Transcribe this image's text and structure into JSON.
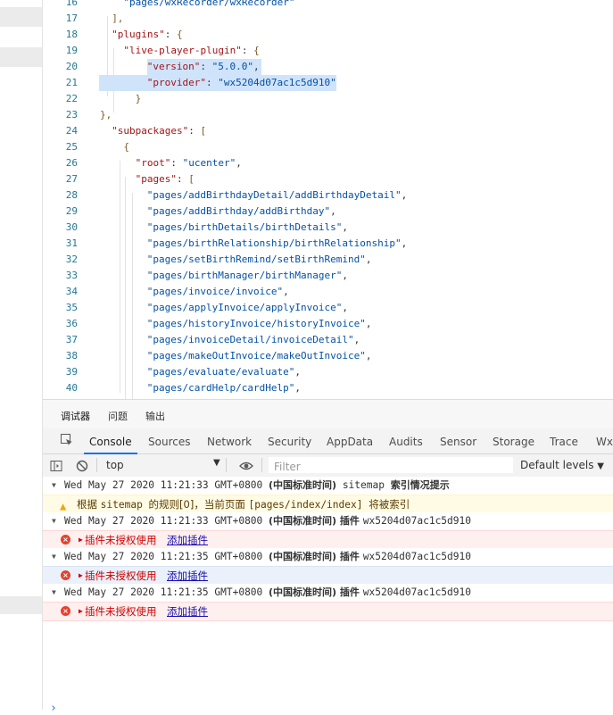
{
  "editor": {
    "lines": [
      {
        "n": "16",
        "indent": 1,
        "parts": [
          {
            "t": "\"pages/wxRecorder/wxRecorder\"",
            "c": "s"
          }
        ]
      },
      {
        "n": "17",
        "indent": 0.5,
        "parts": [
          {
            "t": "],",
            "c": "b"
          }
        ]
      },
      {
        "n": "18",
        "indent": 0.5,
        "parts": [
          {
            "t": "\"plugins\"",
            "c": "k"
          },
          {
            "t": ": ",
            "c": "p"
          },
          {
            "t": "{",
            "c": "b"
          }
        ]
      },
      {
        "n": "19",
        "indent": 1,
        "parts": [
          {
            "t": "\"live-player-plugin\"",
            "c": "k"
          },
          {
            "t": ": ",
            "c": "p"
          },
          {
            "t": "{",
            "c": "b"
          }
        ]
      },
      {
        "n": "20",
        "indent": 2,
        "parts": [
          {
            "t": "\"version\"",
            "c": "k"
          },
          {
            "t": ": ",
            "c": "p"
          },
          {
            "t": "\"5.0.0\"",
            "c": "s"
          },
          {
            "t": ",",
            "c": "p"
          }
        ]
      },
      {
        "n": "21",
        "indent": 2,
        "parts": [
          {
            "t": "\"provider\"",
            "c": "k"
          },
          {
            "t": ": ",
            "c": "p"
          },
          {
            "t": "\"wx5204d07ac1c5d910\"",
            "c": "s"
          }
        ]
      },
      {
        "n": "22",
        "indent": 1.5,
        "parts": [
          {
            "t": "}",
            "c": "b"
          }
        ]
      },
      {
        "n": "23",
        "indent": 0,
        "parts": [
          {
            "t": "},",
            "c": "b"
          }
        ]
      },
      {
        "n": "24",
        "indent": 0.5,
        "parts": [
          {
            "t": "\"subpackages\"",
            "c": "k"
          },
          {
            "t": ": ",
            "c": "p"
          },
          {
            "t": "[",
            "c": "b"
          }
        ]
      },
      {
        "n": "25",
        "indent": 1,
        "parts": [
          {
            "t": "{",
            "c": "b"
          }
        ]
      },
      {
        "n": "26",
        "indent": 1.5,
        "parts": [
          {
            "t": "\"root\"",
            "c": "k"
          },
          {
            "t": ": ",
            "c": "p"
          },
          {
            "t": "\"ucenter\"",
            "c": "s"
          },
          {
            "t": ",",
            "c": "p"
          }
        ]
      },
      {
        "n": "27",
        "indent": 1.5,
        "parts": [
          {
            "t": "\"pages\"",
            "c": "k"
          },
          {
            "t": ": ",
            "c": "p"
          },
          {
            "t": "[",
            "c": "b"
          }
        ]
      },
      {
        "n": "28",
        "indent": 2,
        "parts": [
          {
            "t": "\"pages/addBirthdayDetail/addBirthdayDetail\"",
            "c": "s"
          },
          {
            "t": ",",
            "c": "p"
          }
        ]
      },
      {
        "n": "29",
        "indent": 2,
        "parts": [
          {
            "t": "\"pages/addBirthday/addBirthday\"",
            "c": "s"
          },
          {
            "t": ",",
            "c": "p"
          }
        ]
      },
      {
        "n": "30",
        "indent": 2,
        "parts": [
          {
            "t": "\"pages/birthDetails/birthDetails\"",
            "c": "s"
          },
          {
            "t": ",",
            "c": "p"
          }
        ]
      },
      {
        "n": "31",
        "indent": 2,
        "parts": [
          {
            "t": "\"pages/birthRelationship/birthRelationship\"",
            "c": "s"
          },
          {
            "t": ",",
            "c": "p"
          }
        ]
      },
      {
        "n": "32",
        "indent": 2,
        "parts": [
          {
            "t": "\"pages/setBirthRemind/setBirthRemind\"",
            "c": "s"
          },
          {
            "t": ",",
            "c": "p"
          }
        ]
      },
      {
        "n": "33",
        "indent": 2,
        "parts": [
          {
            "t": "\"pages/birthManager/birthManager\"",
            "c": "s"
          },
          {
            "t": ",",
            "c": "p"
          }
        ]
      },
      {
        "n": "34",
        "indent": 2,
        "parts": [
          {
            "t": "\"pages/invoice/invoice\"",
            "c": "s"
          },
          {
            "t": ",",
            "c": "p"
          }
        ]
      },
      {
        "n": "35",
        "indent": 2,
        "parts": [
          {
            "t": "\"pages/applyInvoice/applyInvoice\"",
            "c": "s"
          },
          {
            "t": ",",
            "c": "p"
          }
        ]
      },
      {
        "n": "36",
        "indent": 2,
        "parts": [
          {
            "t": "\"pages/historyInvoice/historyInvoice\"",
            "c": "s"
          },
          {
            "t": ",",
            "c": "p"
          }
        ]
      },
      {
        "n": "37",
        "indent": 2,
        "parts": [
          {
            "t": "\"pages/invoiceDetail/invoiceDetail\"",
            "c": "s"
          },
          {
            "t": ",",
            "c": "p"
          }
        ]
      },
      {
        "n": "38",
        "indent": 2,
        "parts": [
          {
            "t": "\"pages/makeOutInvoice/makeOutInvoice\"",
            "c": "s"
          },
          {
            "t": ",",
            "c": "p"
          }
        ]
      },
      {
        "n": "39",
        "indent": 2,
        "parts": [
          {
            "t": "\"pages/evaluate/evaluate\"",
            "c": "s"
          },
          {
            "t": ",",
            "c": "p"
          }
        ]
      },
      {
        "n": "40",
        "indent": 2,
        "parts": [
          {
            "t": "\"pages/cardHelp/cardHelp\"",
            "c": "s"
          },
          {
            "t": ",",
            "c": "p"
          }
        ]
      }
    ],
    "selected_lines": [
      "20",
      "21"
    ]
  },
  "devtools": {
    "top_tabs": [
      "调试器",
      "问题",
      "输出"
    ],
    "active_top_tab": "调试器",
    "panel_tabs": [
      "Console",
      "Sources",
      "Network",
      "Security",
      "AppData",
      "Audits",
      "Sensor",
      "Storage",
      "Trace",
      "Wxml"
    ],
    "active_panel_tab": "Console",
    "toolbar": {
      "context": "top",
      "filter_placeholder": "Filter",
      "levels": "Default levels"
    },
    "messages": [
      {
        "type": "group",
        "time": "Wed May 27 2020 11:21:33 GMT+0800",
        "cn": "(中国标准时间)",
        "rest_cn": "sitemap",
        "tail": "索引情况提示"
      },
      {
        "type": "warn",
        "text_cn1": "根据",
        "text_mono1": "sitemap",
        "text_cn2": "的规则[0]，当前页面",
        "text_mono2": "[pages/index/index]",
        "text_cn3": "将被索引"
      },
      {
        "type": "group",
        "time": "Wed May 27 2020 11:21:33 GMT+0800",
        "cn": "(中国标准时间)",
        "rest_cn": "插件",
        "tail": "wx5204d07ac1c5d910"
      },
      {
        "type": "error",
        "text": "插件未授权使用",
        "link": "添加插件",
        "alt": false
      },
      {
        "type": "group",
        "time": "Wed May 27 2020 11:21:35 GMT+0800",
        "cn": "(中国标准时间)",
        "rest_cn": "插件",
        "tail": "wx5204d07ac1c5d910"
      },
      {
        "type": "error",
        "text": "插件未授权使用",
        "link": "添加插件",
        "alt": true
      },
      {
        "type": "group",
        "time": "Wed May 27 2020 11:21:35 GMT+0800",
        "cn": "(中国标准时间)",
        "rest_cn": "插件",
        "tail": "wx5204d07ac1c5d910"
      },
      {
        "type": "error",
        "text": "插件未授权使用",
        "link": "添加插件",
        "alt": false
      }
    ],
    "prompt": "›"
  },
  "colors": {
    "selection": "#cfe3fb",
    "error_text": "#cc0000",
    "warn_bg": "#fffbe5",
    "link": "#1a0dab",
    "accent": "#1a73e8"
  }
}
